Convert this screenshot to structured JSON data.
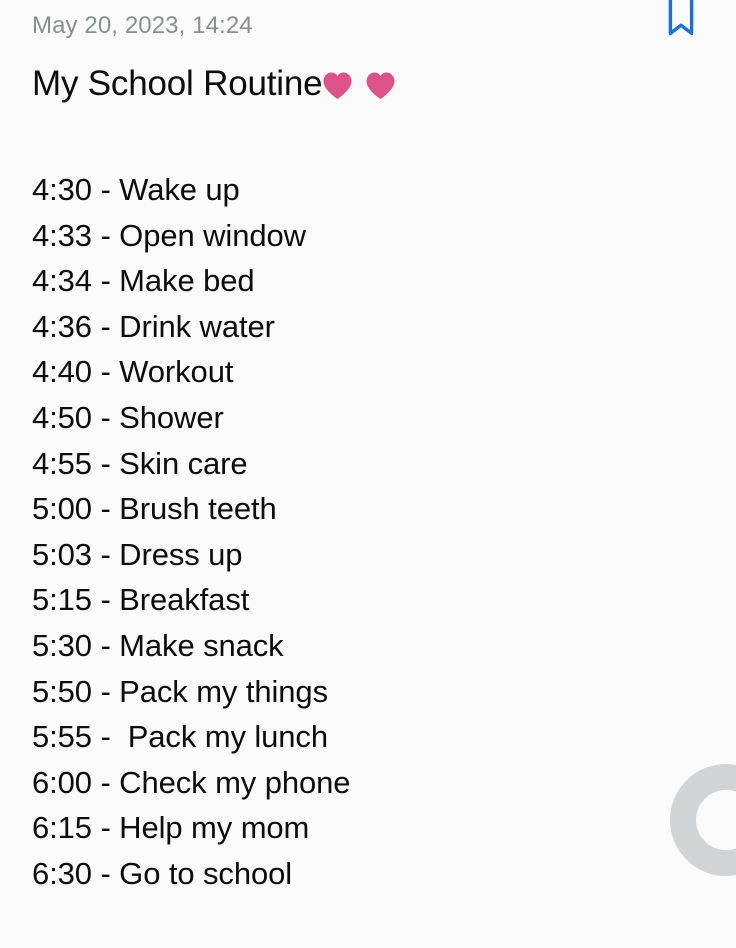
{
  "app": {
    "background_color": "#fafafb",
    "text_color": "#0d0d0d",
    "muted_text_color": "#8b8e91",
    "accent_color": "#1a73d4",
    "heart_color": "#dd5289",
    "ring_color": "#d2d3d5"
  },
  "header": {
    "timestamp": "May 20, 2023, 14:24",
    "bookmark_icon": "bookmark-icon",
    "bookmark_state": "outlined"
  },
  "note": {
    "title_text": "My School Routine",
    "title_emoji": [
      "💗",
      "💗"
    ],
    "emoji_name": "pink-heart",
    "lines": [
      "4:30 - Wake up",
      "4:33 - Open window",
      "4:34 - Make bed",
      "4:36 - Drink water",
      "4:40 - Workout",
      "4:50 - Shower",
      "4:55 - Skin care",
      "5:00 - Brush teeth",
      "5:03 - Dress up",
      "5:15 - Breakfast",
      "5:30 - Make snack",
      "5:50 - Pack my things",
      "5:55 -  Pack my lunch",
      "6:00 - Check my phone",
      "6:15 - Help my mom",
      "6:30 - Go to school"
    ]
  },
  "decoration": {
    "corner_ring": "scroll-indicator-ring"
  }
}
